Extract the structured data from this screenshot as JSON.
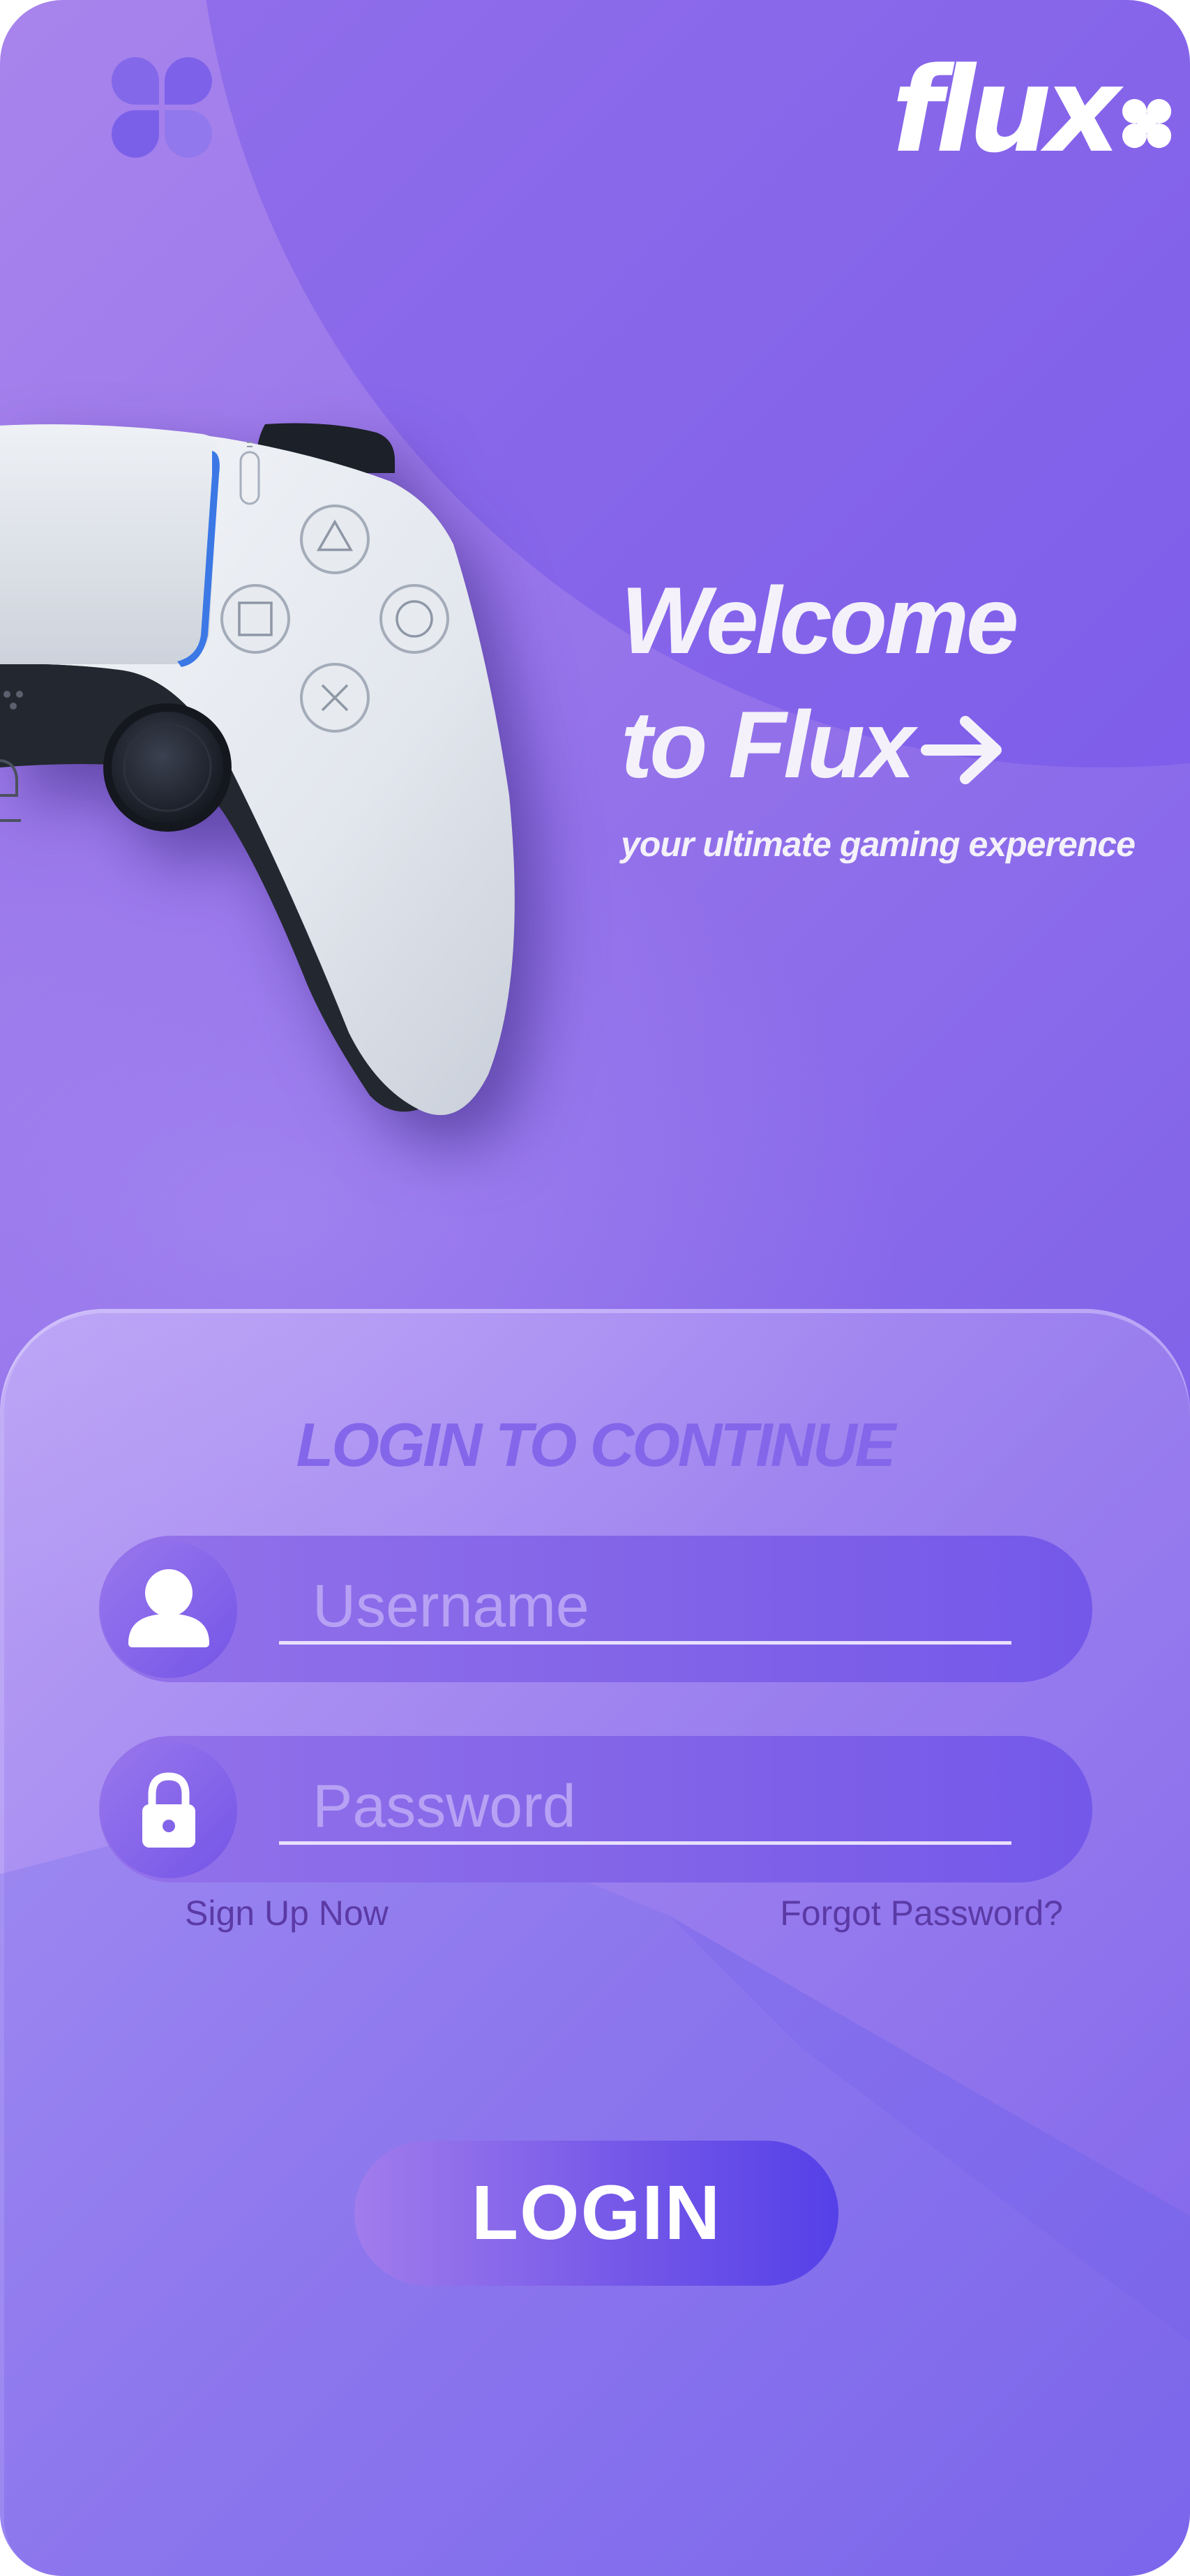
{
  "app": {
    "brand_name": "flux"
  },
  "hero": {
    "title_line1": "Welcome",
    "title_line2": "to Flux",
    "subtitle": "your ultimate gaming experence"
  },
  "login": {
    "heading": "LOGIN TO CONTINUE",
    "username_placeholder": "Username",
    "password_placeholder": "Password",
    "signup_label": "Sign Up Now",
    "forgot_label": "Forgot Password?",
    "login_label": "LOGIN"
  },
  "icons": {
    "logo": "clover-icon",
    "next": "arrow-right-icon",
    "user": "user-icon",
    "lock": "lock-icon"
  },
  "colors": {
    "background_start": "#a884ec",
    "background_end": "#6d55e8",
    "field": "#8264e8",
    "heading": "#8466ea",
    "link": "#5b3aa6",
    "button_end": "#5540e8",
    "text_light": "#f4f1fb"
  }
}
